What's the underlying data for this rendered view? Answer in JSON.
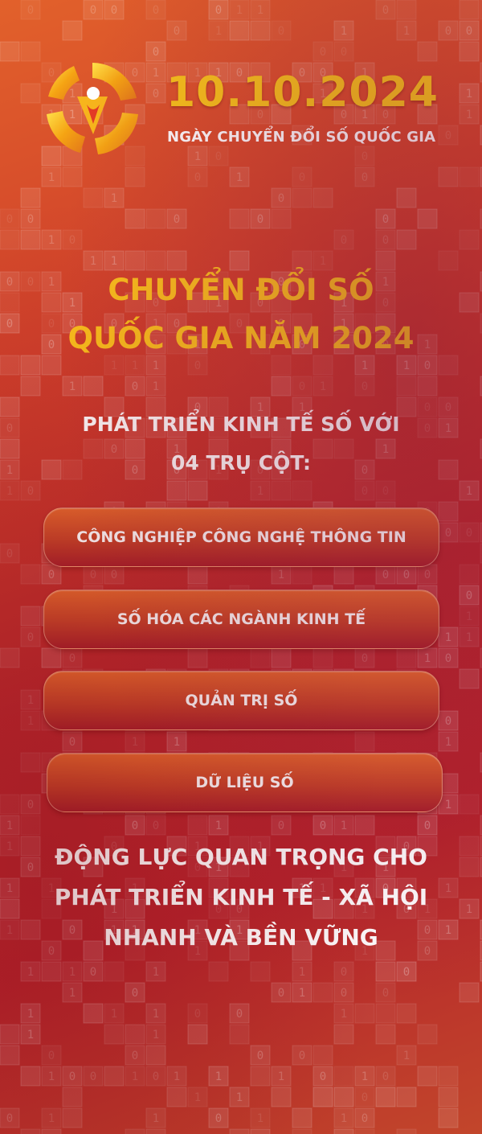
{
  "header": {
    "date": "10.10.2024",
    "day_label": "NGÀY CHUYỂN ĐỔI SỐ QUỐC GIA"
  },
  "headline": {
    "line1": "CHUYỂN ĐỔI SỐ",
    "line2": "QUỐC GIA NĂM 2024"
  },
  "subheading": {
    "line1": "PHÁT TRIỂN KINH TẾ SỐ VỚI",
    "line2": "04 TRỤ CỘT:"
  },
  "pillars": [
    "CÔNG NGHIỆP CÔNG NGHỆ THÔNG TIN",
    "SỐ HÓA CÁC NGÀNH KINH TẾ",
    "QUẢN TRỊ SỐ",
    "DỮ LIỆU SỐ"
  ],
  "footer": {
    "line1": "ĐỘNG LỰC QUAN TRỌNG CHO",
    "line2": "PHÁT TRIỂN KINH TẾ - XÃ HỘI",
    "line3": "NHANH VÀ BỀN VỮNG"
  },
  "colors": {
    "accent_yellow": "#fcc21c",
    "background_red": "#b8262c",
    "background_orange": "#e2612b",
    "text_white": "#ffffff"
  }
}
